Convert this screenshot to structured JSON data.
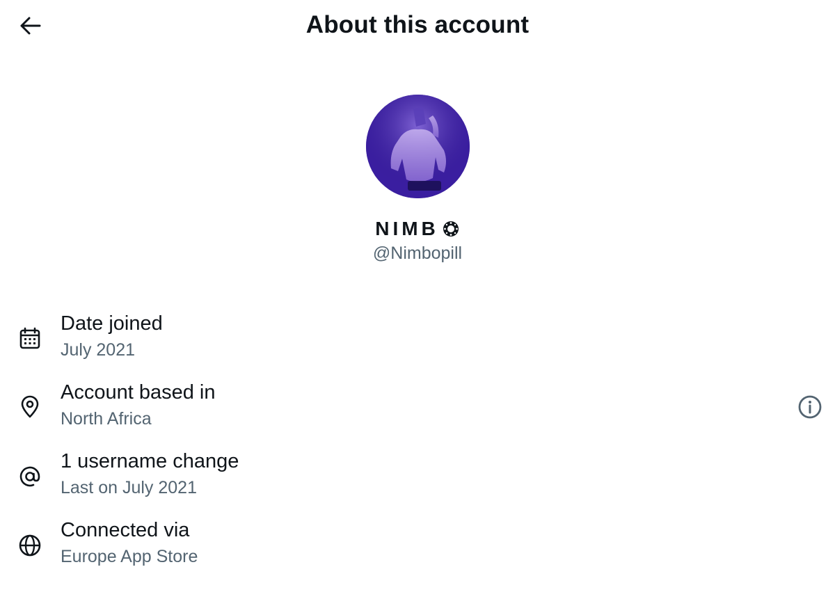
{
  "header": {
    "title": "About this account",
    "back_icon": "arrow-left-icon"
  },
  "profile": {
    "display_name": "NIMB",
    "handle": "@Nimbopill",
    "avatar_desc_colors": {
      "bg": "#3b1fa0",
      "accent": "#6a3fd9"
    }
  },
  "rows": [
    {
      "icon": "calendar-icon",
      "title": "Date joined",
      "subtitle": "July 2021"
    },
    {
      "icon": "location-pin-icon",
      "title": "Account based in",
      "subtitle": "North Africa"
    },
    {
      "icon": "at-sign-icon",
      "title": "1 username change",
      "subtitle": "Last on July 2021"
    },
    {
      "icon": "globe-icon",
      "title": "Connected via",
      "subtitle": "Europe App Store"
    }
  ],
  "colors": {
    "text": "#0f1419",
    "secondary": "#536471",
    "background": "#ffffff"
  }
}
